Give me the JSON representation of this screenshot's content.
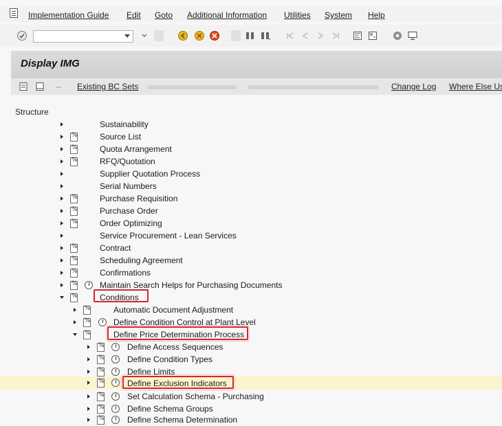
{
  "menu": [
    "Implementation Guide",
    "Edit",
    "Goto",
    "Additional Information",
    "Utilities",
    "System",
    "Help"
  ],
  "page_title": "Display IMG",
  "app_toolbar": {
    "existing_bc_sets": "Existing BC Sets",
    "change_log": "Change Log",
    "where_else_used": "Where Else Us"
  },
  "structure_label": "Structure",
  "tree": [
    {
      "label": "Sustainability"
    },
    {
      "label": "Source List"
    },
    {
      "label": "Quota Arrangement"
    },
    {
      "label": "RFQ/Quotation"
    },
    {
      "label": "Supplier Quotation Process"
    },
    {
      "label": "Serial Numbers"
    },
    {
      "label": "Purchase Requisition"
    },
    {
      "label": "Purchase Order"
    },
    {
      "label": "Order Optimizing"
    },
    {
      "label": "Service Procurement - Lean Services"
    },
    {
      "label": "Contract"
    },
    {
      "label": "Scheduling Agreement"
    },
    {
      "label": "Confirmations"
    },
    {
      "label": "Maintain Search Helps for Purchasing Documents"
    },
    {
      "label": "Conditions"
    },
    {
      "label": "Automatic Document Adjustment"
    },
    {
      "label": "Define Condition Control at Plant Level"
    },
    {
      "label": "Define Price Determination Process"
    },
    {
      "label": "Define Access Sequences"
    },
    {
      "label": "Define Condition Types"
    },
    {
      "label": "Define Limits"
    },
    {
      "label": "Define Exclusion Indicators"
    },
    {
      "label": "Set Calculation Schema - Purchasing"
    },
    {
      "label": "Define Schema Groups"
    },
    {
      "label": "Define Schema Determination"
    }
  ]
}
